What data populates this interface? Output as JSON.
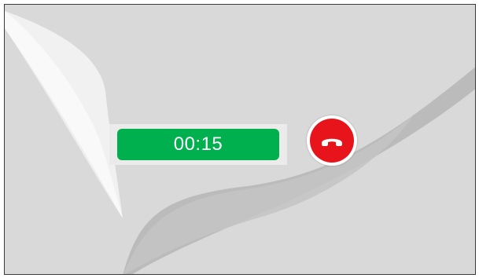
{
  "call": {
    "duration": "00:15"
  },
  "colors": {
    "screen_background": "#d9d9d9",
    "timer_background": "#00b04f",
    "hangup_background": "#e8141b"
  },
  "icons": {
    "hangup": "phone-hangup-icon"
  }
}
